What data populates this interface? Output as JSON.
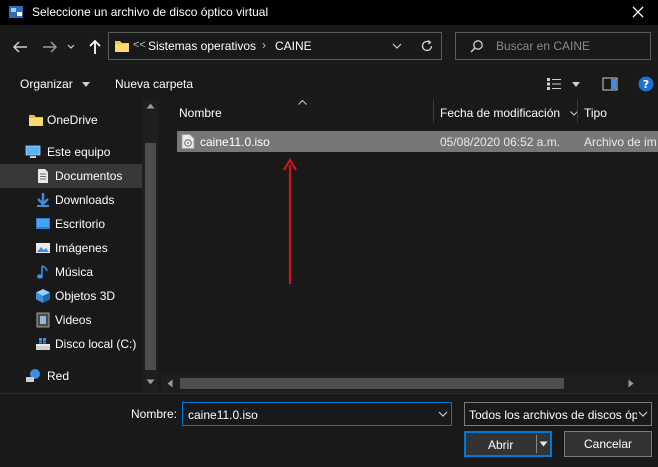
{
  "window": {
    "title": "Seleccione un archivo de disco óptico virtual"
  },
  "address": {
    "breadcrumb_overflow": "<<",
    "path": [
      "Sistemas operativos",
      "CAINE"
    ],
    "separator": "›"
  },
  "search": {
    "placeholder": "Buscar en CAINE"
  },
  "toolbar": {
    "organize_label": "Organizar",
    "new_folder_label": "Nueva carpeta"
  },
  "sidebar": {
    "items": [
      {
        "label": "OneDrive",
        "icon": "folder-icon"
      },
      {
        "label": "Este equipo",
        "icon": "computer-icon"
      },
      {
        "label": "Documentos",
        "icon": "documents-icon"
      },
      {
        "label": "Downloads",
        "icon": "download-icon"
      },
      {
        "label": "Escritorio",
        "icon": "desktop-icon"
      },
      {
        "label": "Imágenes",
        "icon": "pictures-icon"
      },
      {
        "label": "Música",
        "icon": "music-icon"
      },
      {
        "label": "Objetos 3D",
        "icon": "cube-icon"
      },
      {
        "label": "Videos",
        "icon": "video-icon"
      },
      {
        "label": "Disco local (C:)",
        "icon": "drive-icon"
      },
      {
        "label": "Red",
        "icon": "network-icon"
      }
    ]
  },
  "columns": {
    "name": "Nombre",
    "modified": "Fecha de modificación",
    "type": "Tipo"
  },
  "files": [
    {
      "name": "caine11.0.iso",
      "modified": "05/08/2020 06:52 a.m.",
      "type": "Archivo de im"
    }
  ],
  "bottom": {
    "name_label": "Nombre:",
    "name_value": "caine11.0.iso",
    "filter_value": "Todos los archivos de discos óp",
    "open_label": "Abrir",
    "cancel_label": "Cancelar"
  },
  "colors": {
    "accent": "#0078d7",
    "annotation_arrow": "#d0131e",
    "selected_row": "#777777",
    "background": "#191919"
  }
}
